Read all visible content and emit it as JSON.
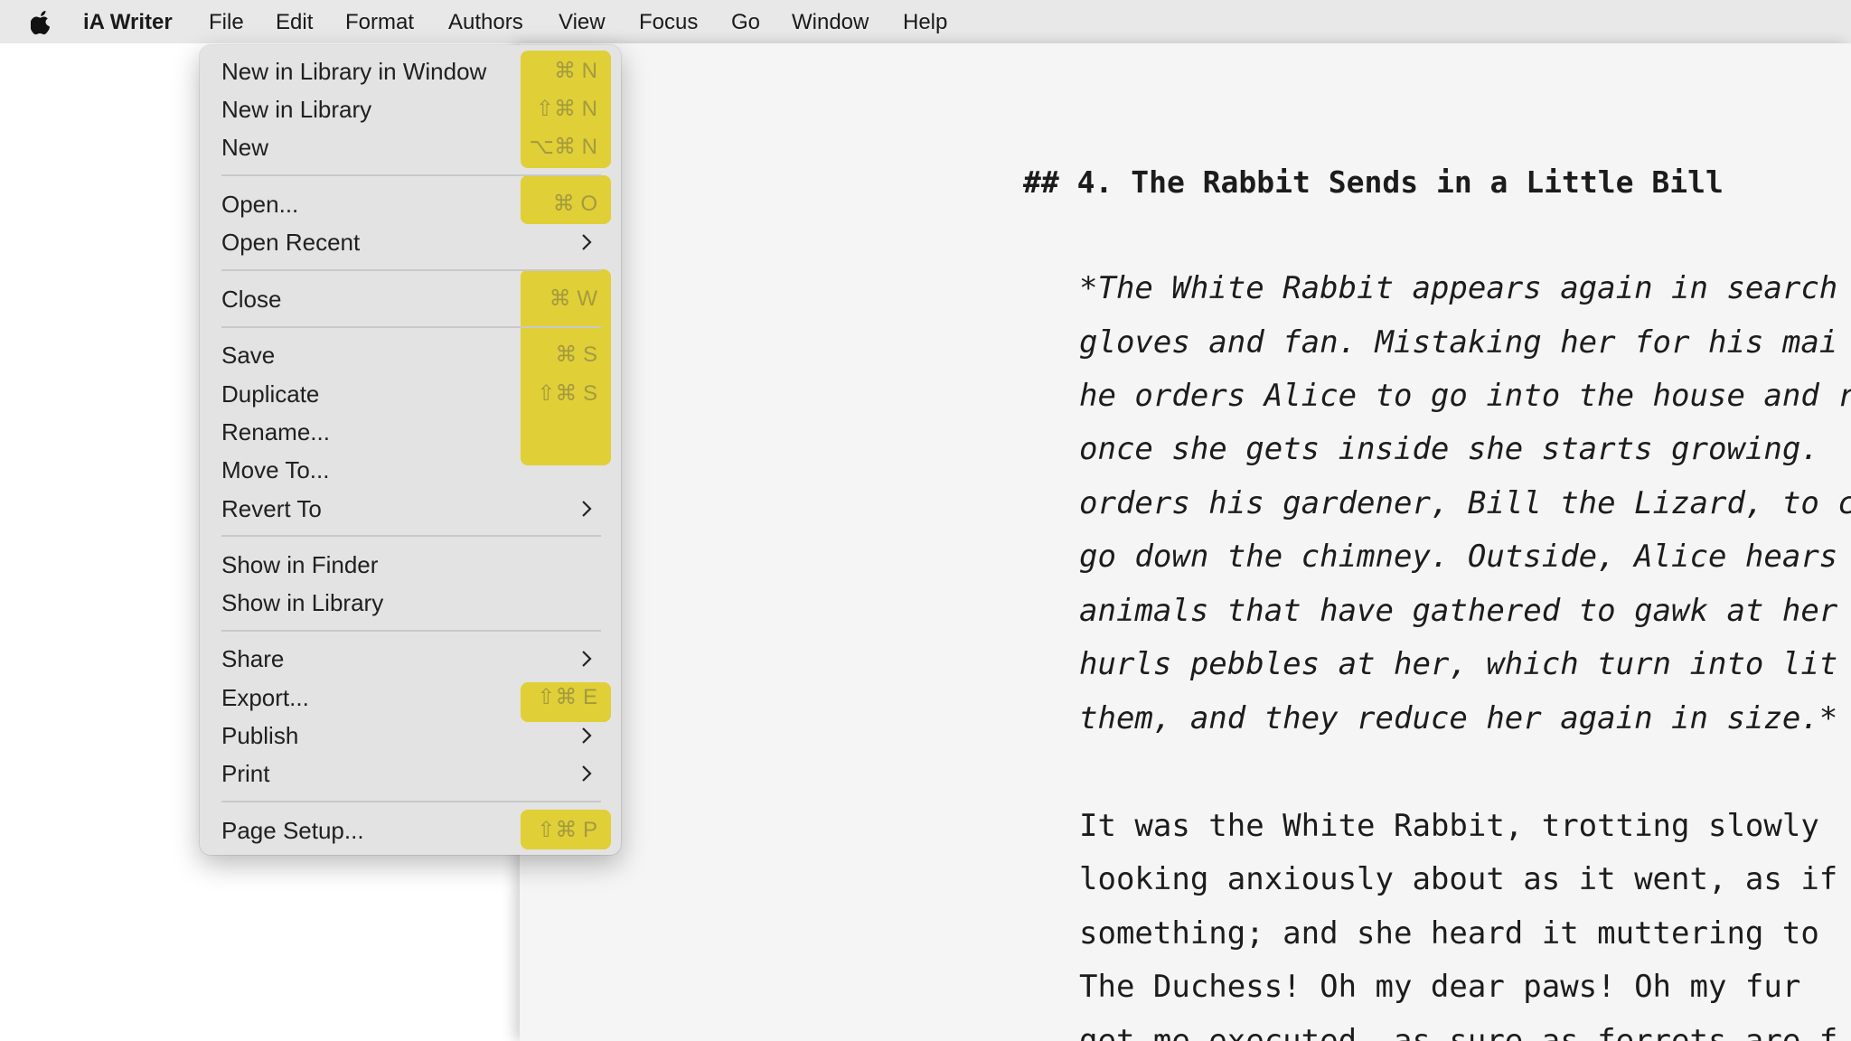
{
  "menubar": {
    "items": [
      "iA Writer",
      "File",
      "Edit",
      "Format",
      "Authors",
      "View",
      "Focus",
      "Go",
      "Window",
      "Help"
    ]
  },
  "file_menu": {
    "items": [
      {
        "label": "New in Library in Window",
        "shortcut": "⌘ N"
      },
      {
        "label": "New in Library",
        "shortcut": "⇧⌘ N"
      },
      {
        "label": "New",
        "shortcut": "⌥⌘ N"
      },
      {
        "label": "Open...",
        "shortcut": "⌘ O"
      },
      {
        "label": "Open Recent",
        "icon": "chevron-right-icon"
      },
      {
        "label": "Close",
        "shortcut": "⌘ W"
      },
      {
        "label": "Save",
        "shortcut": "⌘ S"
      },
      {
        "label": "Duplicate",
        "shortcut": "⇧⌘ S"
      },
      {
        "label": "Rename..."
      },
      {
        "label": "Move To..."
      },
      {
        "label": "Revert To",
        "icon": "chevron-right-icon"
      },
      {
        "label": "Show in Finder"
      },
      {
        "label": "Show in Library"
      },
      {
        "label": "Share",
        "icon": "chevron-right-icon"
      },
      {
        "label": "Export...",
        "shortcut": "⇧⌘ E"
      },
      {
        "label": "Publish",
        "icon": "chevron-right-icon"
      },
      {
        "label": "Print",
        "icon": "chevron-right-icon"
      },
      {
        "label": "Page Setup...",
        "shortcut": "⇧⌘ P"
      }
    ]
  },
  "colors": {
    "highlight": "#e0cf36",
    "menu_bg": "#e3e3e3",
    "doc_bg": "#f5f5f5"
  },
  "document": {
    "heading": "## 4. The Rabbit Sends in a Little Bill",
    "summary_lines": [
      "*The White Rabbit appears again in search",
      "gloves and fan. Mistaking her for his mai",
      "he orders Alice to go into the house and r",
      "once she gets inside she starts growing.",
      "orders his gardener, Bill the Lizard, to c",
      "go down the chimney. Outside, Alice hears",
      "animals that have gathered to gawk at her",
      "hurls pebbles at her, which turn into lit",
      "them, and they reduce her again in size.*"
    ],
    "body_lines": [
      "It was the White Rabbit, trotting slowly",
      "looking anxiously about as it went, as if",
      "something; and she heard it muttering to",
      "The Duchess! Oh my dear paws! Oh my fur",
      "get me executed, as sure as ferrets are f"
    ]
  }
}
